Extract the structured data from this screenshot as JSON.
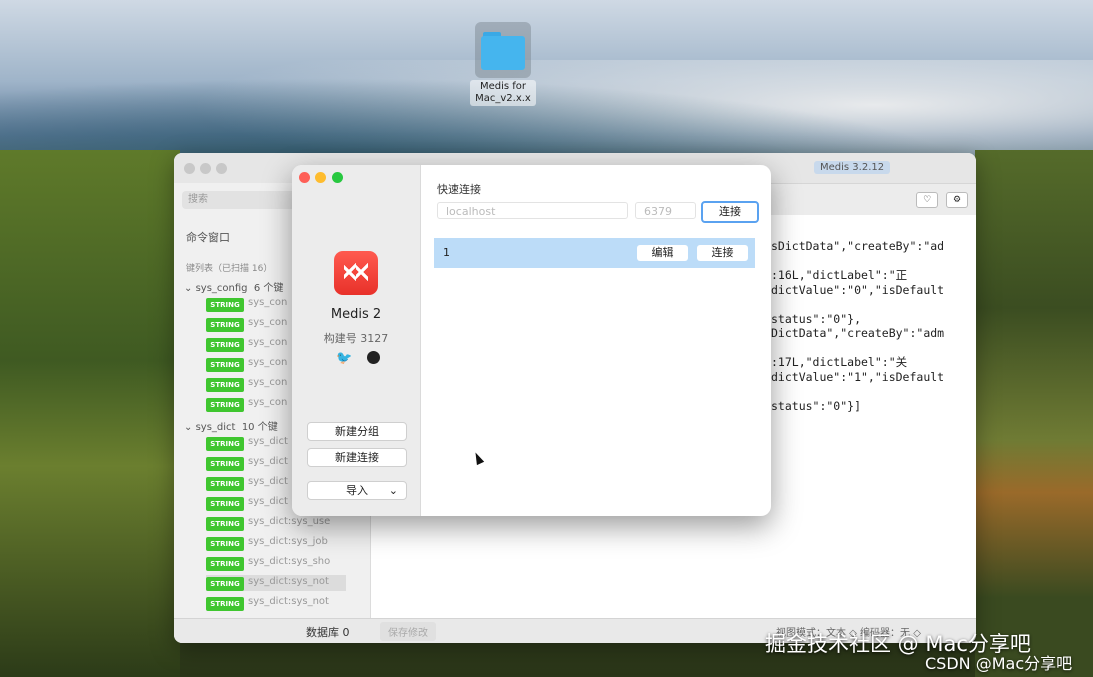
{
  "desktop": {
    "folder_label": "Medis for Mac_v2.x.x"
  },
  "bg_window": {
    "version": "Medis 3.2.12",
    "search_placeholder": "搜索",
    "command_window": "命令窗口",
    "key_list_header": "键列表（已扫描 16）",
    "groups": [
      {
        "name": "sys_config",
        "count": "6 个键",
        "keys": [
          "sys_con",
          "sys_con",
          "sys_con",
          "sys_con",
          "sys_con",
          "sys_con"
        ]
      },
      {
        "name": "sys_dict",
        "count": "10 个键",
        "keys": [
          "sys_dict",
          "sys_dict",
          "sys_dict",
          "sys_dict",
          "sys_dict:sys_use",
          "sys_dict:sys_job",
          "sys_dict:sys_sho",
          "sys_dict:sys_not",
          "sys_dict:sys_not"
        ]
      }
    ],
    "badge_label": "STRING",
    "database": "数据库 0",
    "save_label": "保存修改",
    "mode_label": "视图模式：文本 ◇    编码器：无 ◇",
    "code_lines": [
      "sDictData\",\"createBy\":\"ad",
      "",
      ":16L,\"dictLabel\":\"正",
      "dictValue\":\"0\",\"isDefault",
      "",
      "status\":\"0\"},",
      "DictData\",\"createBy\":\"adm",
      "",
      ":17L,\"dictLabel\":\"关",
      "dictValue\":\"1\",\"isDefault",
      "",
      "status\":\"0\"}]"
    ]
  },
  "dialog": {
    "app_name": "Medis 2",
    "build": "构建号 3127",
    "new_group": "新建分组",
    "new_connection": "新建连接",
    "import": "导入",
    "quick_connect_title": "快速连接",
    "host_placeholder": "localhost",
    "port_placeholder": "6379",
    "connect_label": "连接",
    "connection": {
      "name": "1",
      "edit": "编辑",
      "connect": "连接"
    }
  },
  "watermark": {
    "line1": "掘金技术社区 @ Mac分享吧",
    "line2": "CSDN @Mac分享吧"
  }
}
